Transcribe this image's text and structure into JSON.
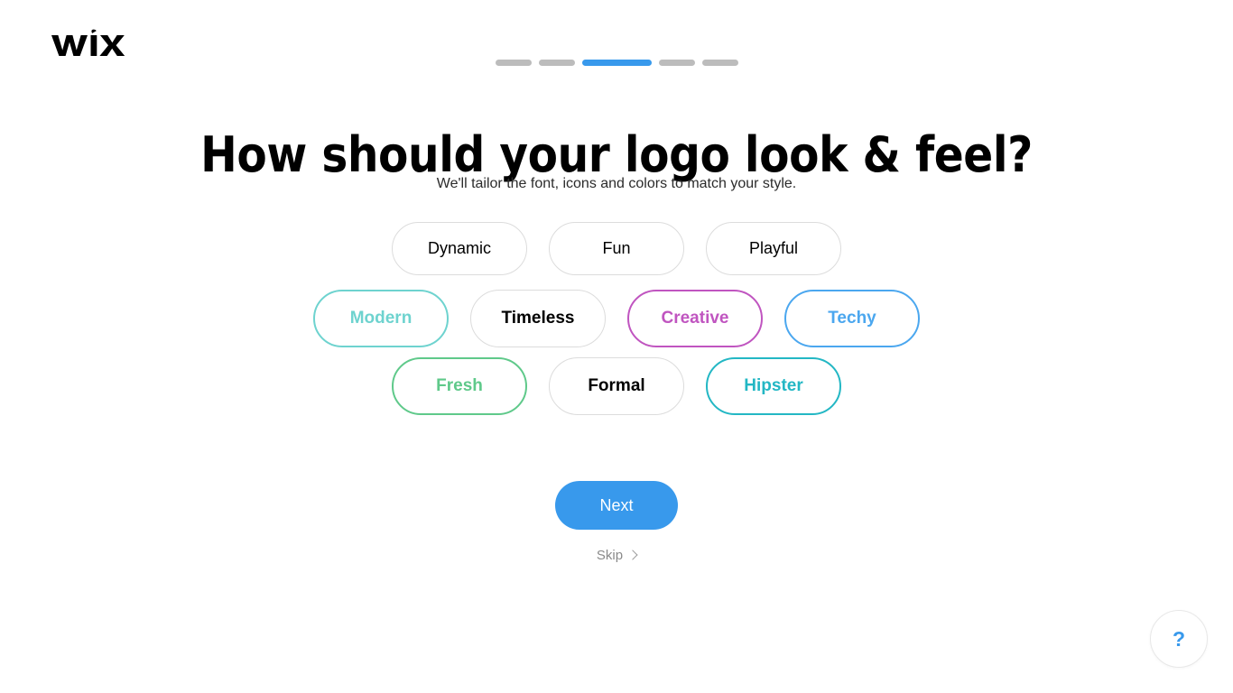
{
  "brand": {
    "logo_text": "WiX",
    "accent_color": "#3899ec"
  },
  "progress": {
    "total_steps": 5,
    "current_step": 3,
    "inactive_color": "#bcbcbc",
    "active_color": "#3899ec",
    "segments": [
      {
        "state": "inactive"
      },
      {
        "state": "inactive"
      },
      {
        "state": "active"
      },
      {
        "state": "inactive"
      },
      {
        "state": "inactive"
      }
    ]
  },
  "header": {
    "title": "How should your logo look & feel?",
    "subtitle": "We'll tailor the font, icons and colors to match your style."
  },
  "chips": {
    "rows": [
      [
        {
          "label": "Dynamic",
          "selected": false,
          "color": "#000000"
        },
        {
          "label": "Fun",
          "selected": false,
          "color": "#000000"
        },
        {
          "label": "Playful",
          "selected": false,
          "color": "#000000"
        }
      ],
      [
        {
          "label": "Modern",
          "selected": true,
          "color": "#6ed3cf"
        },
        {
          "label": "Timeless",
          "selected": false,
          "color": "#000000"
        },
        {
          "label": "Creative",
          "selected": true,
          "color": "#c055c0"
        },
        {
          "label": "Techy",
          "selected": true,
          "color": "#4ba7ef"
        }
      ],
      [
        {
          "label": "Fresh",
          "selected": true,
          "color": "#5fc98a"
        },
        {
          "label": "Formal",
          "selected": false,
          "color": "#000000"
        },
        {
          "label": "Hipster",
          "selected": true,
          "color": "#23b7c4"
        }
      ]
    ]
  },
  "actions": {
    "next_label": "Next",
    "skip_label": "Skip"
  },
  "help": {
    "glyph": "?"
  }
}
